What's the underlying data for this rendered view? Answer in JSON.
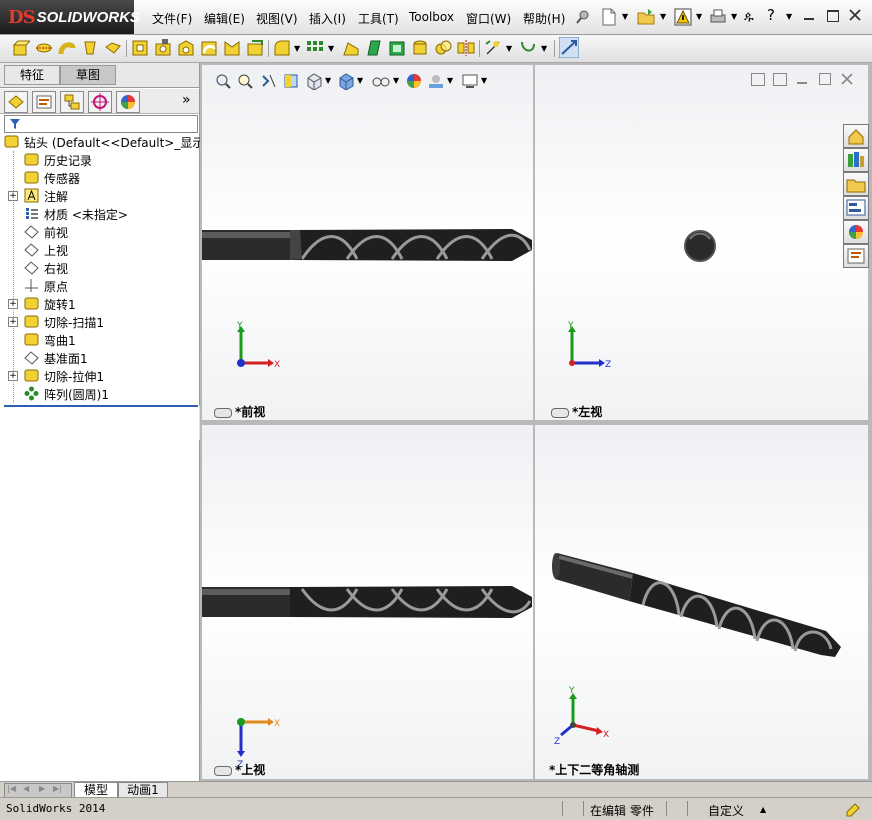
{
  "app": {
    "logo_ds": "DS",
    "logo_text": "SOLIDWORKS"
  },
  "menu": [
    {
      "label": "文件(F)",
      "name": "menu-file"
    },
    {
      "label": "编辑(E)",
      "name": "menu-edit"
    },
    {
      "label": "视图(V)",
      "name": "menu-view"
    },
    {
      "label": "插入(I)",
      "name": "menu-insert"
    },
    {
      "label": "工具(T)",
      "name": "menu-tools"
    },
    {
      "label": "Toolbox",
      "name": "menu-toolbox"
    },
    {
      "label": "窗口(W)",
      "name": "menu-window"
    },
    {
      "label": "帮助(H)",
      "name": "menu-help"
    }
  ],
  "left_pane": {
    "tabs": [
      {
        "label": "特征",
        "name": "tab-features"
      },
      {
        "label": "草图",
        "name": "tab-sketch"
      }
    ],
    "more_glyph": "»",
    "filter_glyph": "▼",
    "tree": [
      {
        "label": "钻头  (Default<<Default>_显示",
        "icon": "part-icon",
        "expand": false,
        "root": true
      },
      {
        "label": "历史记录",
        "icon": "history-icon",
        "expand": false
      },
      {
        "label": "传感器",
        "icon": "sensor-icon",
        "expand": false
      },
      {
        "label": "注解",
        "icon": "annotation-icon",
        "expand": true
      },
      {
        "label": "材质 <未指定>",
        "icon": "material-icon",
        "expand": false
      },
      {
        "label": "前视",
        "icon": "plane-icon",
        "expand": false
      },
      {
        "label": "上视",
        "icon": "plane-icon",
        "expand": false
      },
      {
        "label": "右视",
        "icon": "plane-icon",
        "expand": false
      },
      {
        "label": "原点",
        "icon": "origin-icon",
        "expand": false
      },
      {
        "label": "旋转1",
        "icon": "revolve-icon",
        "expand": true
      },
      {
        "label": "切除-扫描1",
        "icon": "sweep-cut-icon",
        "expand": true
      },
      {
        "label": "弯曲1",
        "icon": "flex-icon",
        "expand": false
      },
      {
        "label": "基准面1",
        "icon": "plane-icon",
        "expand": false
      },
      {
        "label": "切除-拉伸1",
        "icon": "extrude-cut-icon",
        "expand": true
      },
      {
        "label": "阵列(圆周)1",
        "icon": "circular-pattern-icon",
        "expand": false
      }
    ]
  },
  "viewports": [
    {
      "name": "viewport-front",
      "label": "*前视",
      "axes": {
        "up": "Y",
        "right": "X"
      }
    },
    {
      "name": "viewport-left",
      "label": "*左视",
      "axes": {
        "up": "Y",
        "right": "Z"
      }
    },
    {
      "name": "viewport-top",
      "label": "*上视",
      "axes": {
        "down": "Z",
        "right": "X"
      }
    },
    {
      "name": "viewport-trimetric",
      "label": "*上下二等角轴测",
      "axes": {
        "up": "Y",
        "right": "X",
        "left": "Z"
      }
    }
  ],
  "bottom_tabs": [
    {
      "label": "模型",
      "name": "tab-model"
    },
    {
      "label": "动画1",
      "name": "tab-motion1"
    }
  ],
  "status": {
    "version": "SolidWorks 2014",
    "mode": "在编辑 零件",
    "units": "自定义",
    "units_glyph": "▲"
  },
  "colors": {
    "accent_blue": "#2f5fb3",
    "brand_red": "#e23a2e",
    "drill_dark": "#2b2b2b",
    "axis_x": "#d32020",
    "axis_y": "#1a9a1a",
    "axis_z": "#2030c8"
  }
}
